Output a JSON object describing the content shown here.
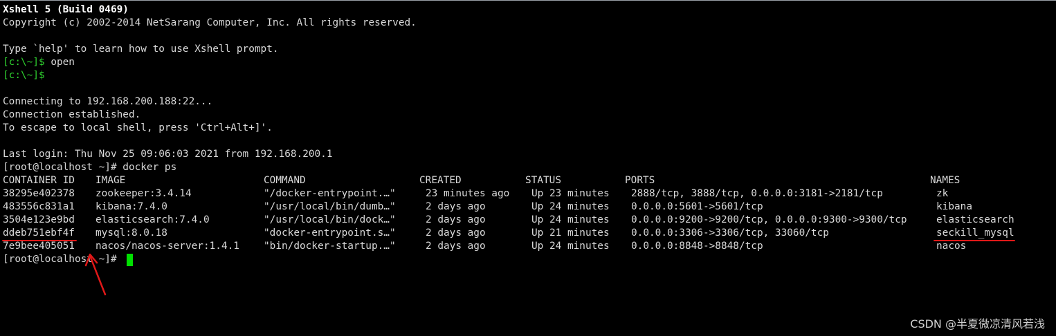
{
  "terminal": {
    "banner_title": "Xshell 5 (Build 0469)",
    "banner_copyright": "Copyright (c) 2002-2014 NetSarang Computer, Inc. All rights reserved.",
    "help_hint": "Type `help' to learn how to use Xshell prompt.",
    "local_prompt": "[c:\\~]$",
    "open_command": " open",
    "connecting": "Connecting to 192.168.200.188:22...",
    "established": "Connection established.",
    "escape_hint": "To escape to local shell, press 'Ctrl+Alt+]'.",
    "last_login": "Last login: Thu Nov 25 09:06:03 2021 from 192.168.200.1",
    "docker_command": "[root@localhost ~]# docker ps",
    "final_prompt": "[root@localhost ~]# "
  },
  "docker_ps": {
    "headers": {
      "container_id": "CONTAINER ID",
      "image": "IMAGE",
      "command": "COMMAND",
      "created": "CREATED",
      "status": "STATUS",
      "ports": "PORTS",
      "names": "NAMES"
    },
    "rows": [
      {
        "container_id": "38295e402378",
        "image": "zookeeper:3.4.14",
        "command": "\"/docker-entrypoint.…\"",
        "created": "23 minutes ago",
        "status": "Up 23 minutes",
        "ports": "2888/tcp, 3888/tcp, 0.0.0.0:3181->2181/tcp",
        "names": "zk"
      },
      {
        "container_id": "483556c831a1",
        "image": "kibana:7.4.0",
        "command": "\"/usr/local/bin/dumb…\"",
        "created": "2 days ago",
        "status": "Up 24 minutes",
        "ports": "0.0.0.0:5601->5601/tcp",
        "names": "kibana"
      },
      {
        "container_id": "3504e123e9bd",
        "image": "elasticsearch:7.4.0",
        "command": "\"/usr/local/bin/dock…\"",
        "created": "2 days ago",
        "status": "Up 24 minutes",
        "ports": "0.0.0.0:9200->9200/tcp, 0.0.0.0:9300->9300/tcp",
        "names": "elasticsearch"
      },
      {
        "container_id": "ddeb751ebf4f",
        "image": "mysql:8.0.18",
        "command": "\"docker-entrypoint.s…\"",
        "created": "2 days ago",
        "status": "Up 21 minutes",
        "ports": "0.0.0.0:3306->3306/tcp, 33060/tcp",
        "names": "seckill_mysql"
      },
      {
        "container_id": "7e9bee405051",
        "image": "nacos/nacos-server:1.4.1",
        "command": "\"bin/docker-startup.…\"",
        "created": "2 days ago",
        "status": "Up 24 minutes",
        "ports": "0.0.0.0:8848->8848/tcp",
        "names": "nacos"
      }
    ]
  },
  "watermark": "CSDN @半夏微凉清风若浅",
  "colors": {
    "background": "#000000",
    "text": "#d8d8d8",
    "prompt_green": "#2fd12f",
    "cursor": "#00e000",
    "annotation_red": "#e01818"
  }
}
